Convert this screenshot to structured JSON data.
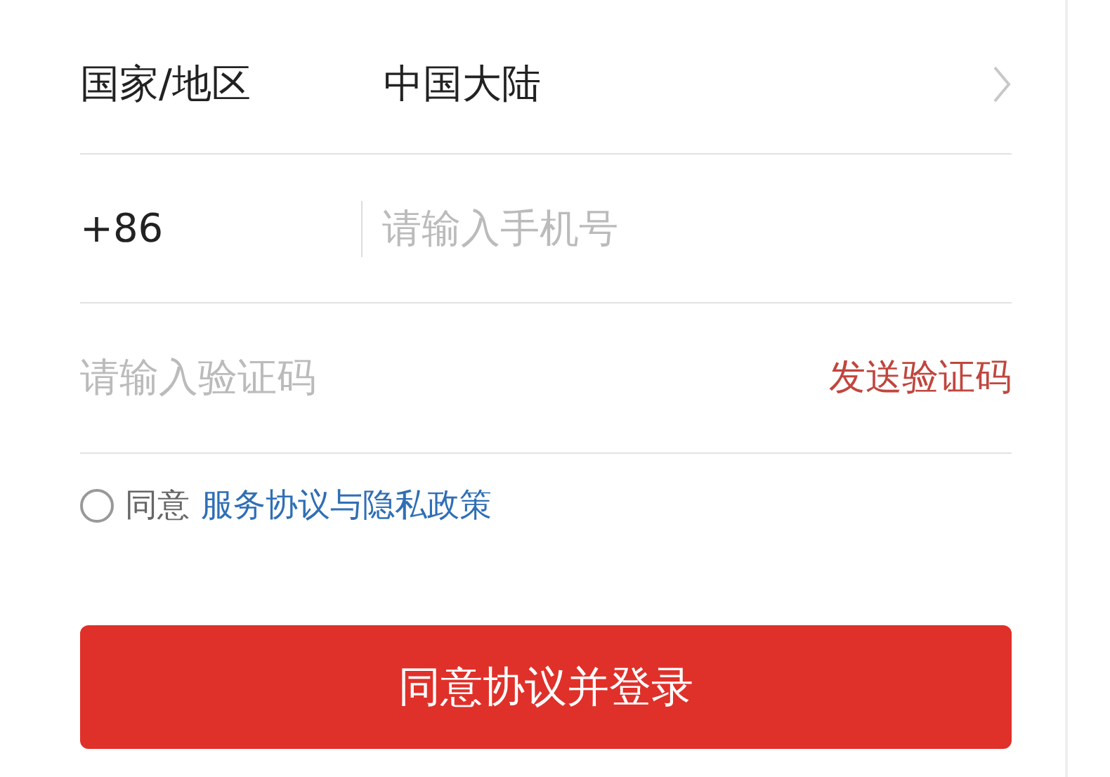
{
  "region": {
    "label": "国家/地区",
    "value": "中国大陆"
  },
  "phone": {
    "code": "+86",
    "placeholder": "请输入手机号"
  },
  "verification": {
    "placeholder": "请输入验证码",
    "send": "发送验证码"
  },
  "agreement": {
    "checked": false,
    "text": "同意",
    "link": "服务协议与隐私政策"
  },
  "login": {
    "label": "同意协议并登录"
  }
}
